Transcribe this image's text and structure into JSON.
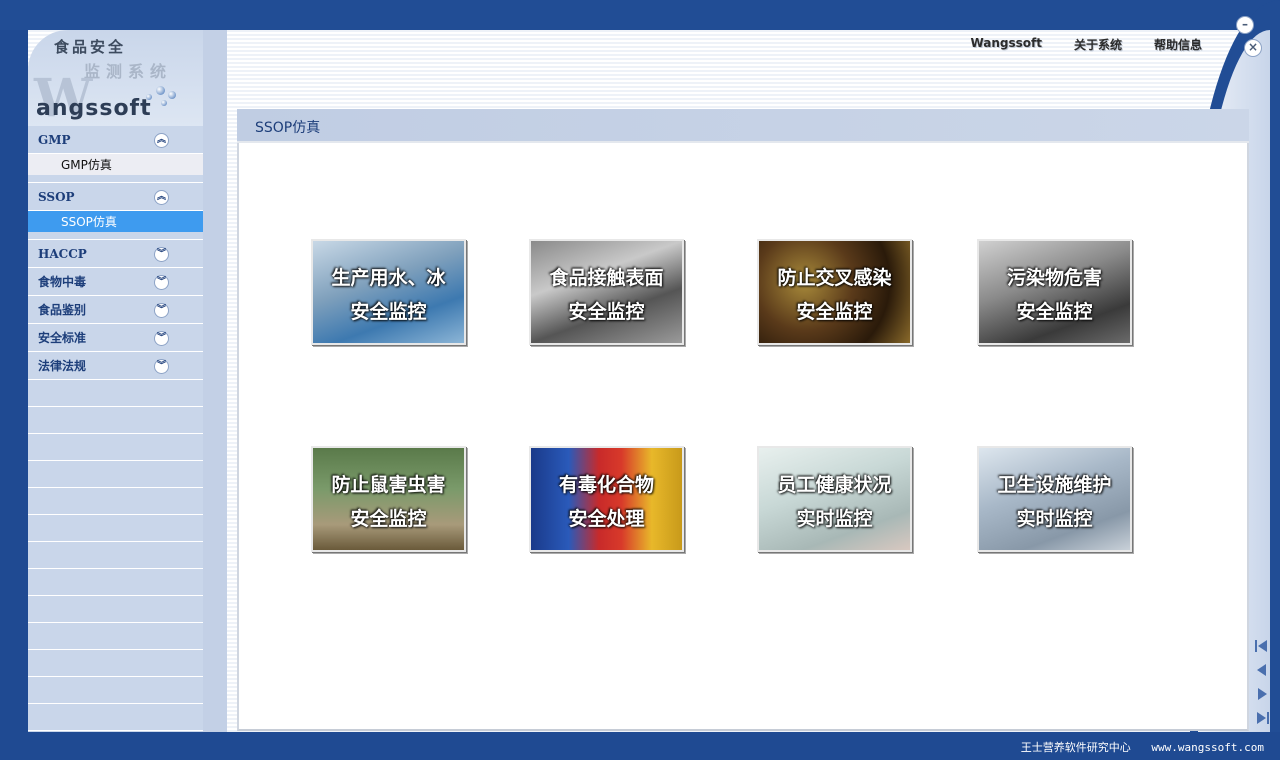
{
  "logo": {
    "line1": "食品安全",
    "line2": "监测系统",
    "brand_initial": "W",
    "brand": "angssoft"
  },
  "top_links": [
    "Wangssoft",
    "关于系统",
    "帮助信息"
  ],
  "window_controls": {
    "minimize_icon": "minus-circle-icon",
    "close_icon": "close-circle-icon"
  },
  "sidebar": {
    "groups": [
      {
        "label": "GMP",
        "expanded": true,
        "items": [
          "GMP仿真"
        ]
      },
      {
        "label": "SSOP",
        "expanded": true,
        "items": [
          "SSOP仿真"
        ],
        "active_item": "SSOP仿真"
      },
      {
        "label": "HACCP",
        "expanded": false
      },
      {
        "label": "食物中毒",
        "expanded": false
      },
      {
        "label": "食品鉴别",
        "expanded": false
      },
      {
        "label": "安全标准",
        "expanded": false
      },
      {
        "label": "法律法规",
        "expanded": false
      }
    ]
  },
  "panel": {
    "title": "SSOP仿真"
  },
  "tiles": [
    {
      "line1": "生产用水、冰",
      "line2": "安全监控"
    },
    {
      "line1": "食品接触表面",
      "line2": "安全监控"
    },
    {
      "line1": "防止交叉感染",
      "line2": "安全监控"
    },
    {
      "line1": "污染物危害",
      "line2": "安全监控"
    },
    {
      "line1": "防止鼠害虫害",
      "line2": "安全监控"
    },
    {
      "line1": "有毒化合物",
      "line2": "安全处理"
    },
    {
      "line1": "员工健康状况",
      "line2": "实时监控"
    },
    {
      "line1": "卫生设施维护",
      "line2": "实时监控"
    }
  ],
  "pager_icons": [
    "first-page-icon",
    "prev-page-icon",
    "next-page-icon",
    "last-page-icon"
  ],
  "footer": {
    "org": "王士营养软件研究中心",
    "url": "www.wangssoft.com"
  },
  "colors": {
    "frame_blue": "#1f4a92",
    "sidebar": "#c9d6ea",
    "active": "#3e9bef",
    "title_text": "#1d3e7a"
  }
}
